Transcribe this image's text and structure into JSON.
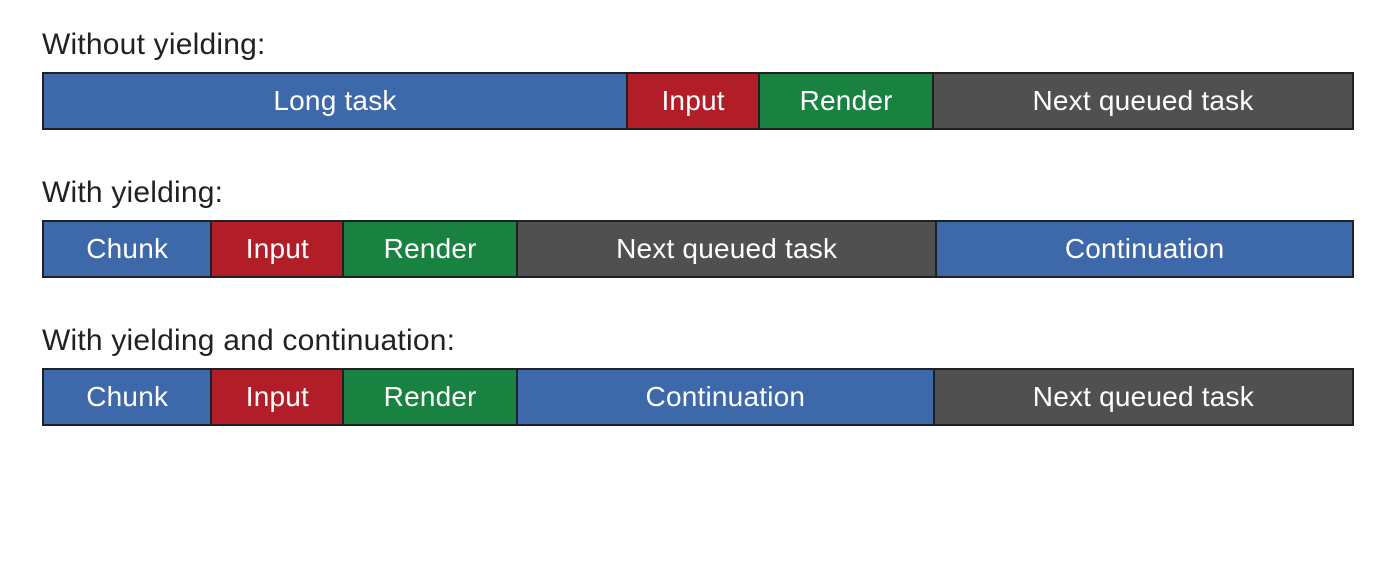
{
  "sections": [
    {
      "title": "Without yielding:",
      "segments": [
        {
          "label": "Long task",
          "color": "blue",
          "flex": 44.7
        },
        {
          "label": "Input",
          "color": "red",
          "flex": 10.0
        },
        {
          "label": "Render",
          "color": "green",
          "flex": 13.2
        },
        {
          "label": "Next queued task",
          "color": "gray",
          "flex": 32.1
        }
      ]
    },
    {
      "title": "With yielding:",
      "segments": [
        {
          "label": "Chunk",
          "color": "blue",
          "flex": 12.8
        },
        {
          "label": "Input",
          "color": "red",
          "flex": 10.0
        },
        {
          "label": "Render",
          "color": "green",
          "flex": 13.2
        },
        {
          "label": "Next queued task",
          "color": "gray",
          "flex": 32.1
        },
        {
          "label": "Continuation",
          "color": "blue",
          "flex": 31.9
        }
      ]
    },
    {
      "title": "With yielding and continuation:",
      "segments": [
        {
          "label": "Chunk",
          "color": "blue",
          "flex": 12.8
        },
        {
          "label": "Input",
          "color": "red",
          "flex": 10.0
        },
        {
          "label": "Render",
          "color": "green",
          "flex": 13.2
        },
        {
          "label": "Continuation",
          "color": "blue",
          "flex": 31.9
        },
        {
          "label": "Next queued task",
          "color": "gray",
          "flex": 32.1
        }
      ]
    }
  ]
}
